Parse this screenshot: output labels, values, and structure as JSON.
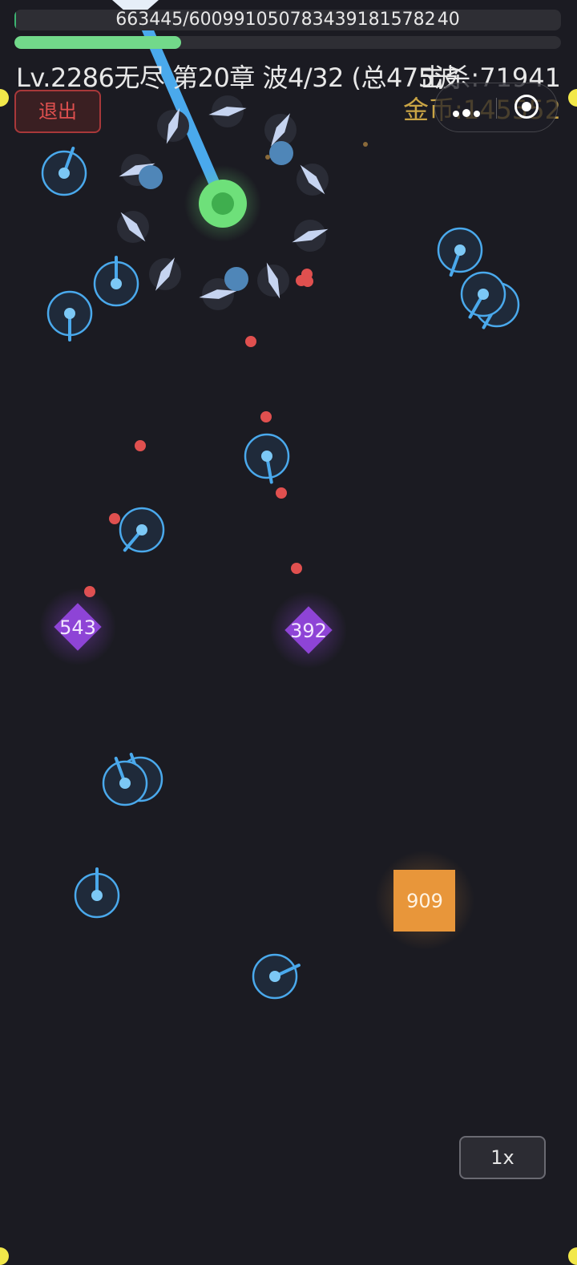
{
  "hud": {
    "hp_text": "663445/6009910507834391815782 40",
    "hp_fraction": 0.0,
    "xp_fraction": 0.305,
    "level": "Lv.2286",
    "mode": "无尽",
    "chapter": "第20章",
    "wave": "波4/32",
    "total": "(总475波",
    "kills": "击杀:71941",
    "gold": "金币:145552"
  },
  "buttons": {
    "exit_label": "退出",
    "speed_label": "1x"
  },
  "enemies": {
    "diamond_1": "543",
    "diamond_2": "392",
    "square_1": "909"
  },
  "colors": {
    "background": "#1b1b22",
    "player": "#6ee07a",
    "turret": "#4aa9ec",
    "projectile": "#e0504f",
    "diamond_enemy": "#8e44d6",
    "square_enemy": "#e8963a",
    "gold_text": "#c9a445"
  }
}
